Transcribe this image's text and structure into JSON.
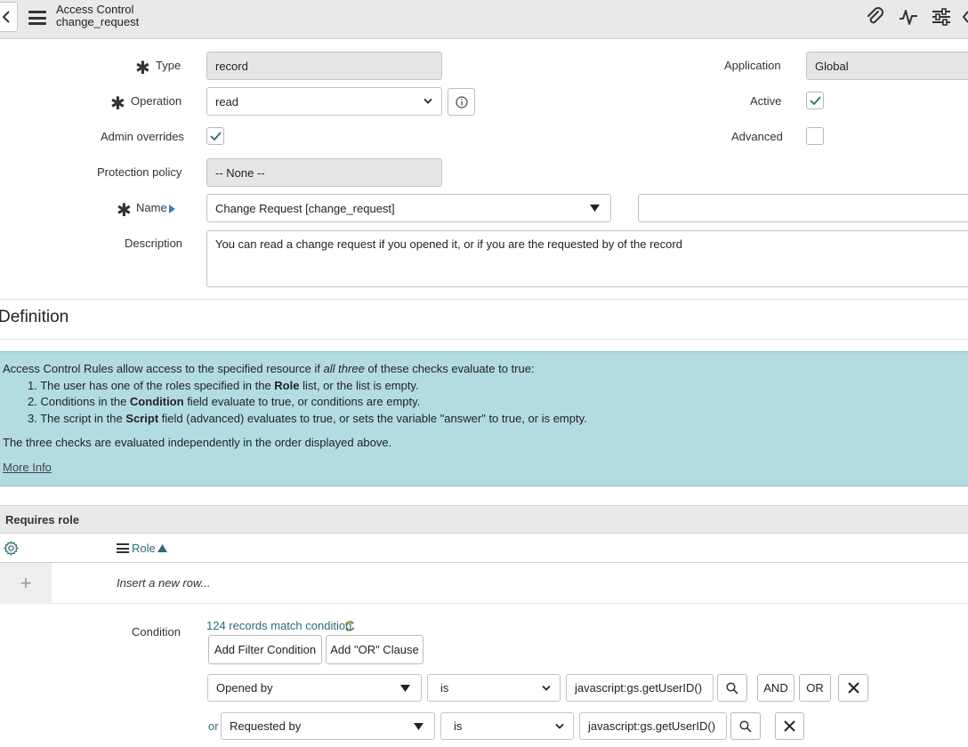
{
  "header": {
    "title": "Access Control",
    "subtitle": "change_request",
    "icons": [
      "back-icon",
      "menu-icon",
      "attachment-icon",
      "activity-icon",
      "settings-sliders-icon",
      "more-icon"
    ]
  },
  "form": {
    "type_label": "Type",
    "type_value": "record",
    "operation_label": "Operation",
    "operation_value": "read",
    "admin_overrides_label": "Admin overrides",
    "admin_overrides_checked": true,
    "protection_policy_label": "Protection policy",
    "protection_policy_value": "-- None --",
    "name_label": "Name",
    "name_value": "Change Request [change_request]",
    "name_field_value": "",
    "description_label": "Description",
    "description_value": "You can read a change request if you opened it, or if you are the requested by of the record",
    "application_label": "Application",
    "application_value": "Global",
    "active_label": "Active",
    "active_checked": true,
    "advanced_label": "Advanced",
    "advanced_checked": false
  },
  "definition": {
    "title": "Definition",
    "intro_before": "Access Control Rules allow access to the specified resource if ",
    "intro_em": "all three",
    "intro_after": " of these checks evaluate to true:",
    "items": [
      {
        "num": "1.",
        "before": "The user has one of the roles specified in the ",
        "bold": "Role",
        "after": " list, or the list is empty."
      },
      {
        "num": "2.",
        "before": "Conditions in the ",
        "bold": "Condition",
        "after": " field evaluate to true, or conditions are empty."
      },
      {
        "num": "3.",
        "before": "The script in the ",
        "bold": "Script",
        "after": " field (advanced) evaluates to true, or sets the variable \"answer\" to true, or is empty."
      }
    ],
    "footer": "The three checks are evaluated independently in the order displayed above.",
    "more_info": "More Info"
  },
  "roles": {
    "section_title": "Requires role",
    "column": "Role",
    "insert_placeholder": "Insert a new row..."
  },
  "condition": {
    "label": "Condition",
    "match_text": "124 records match condition",
    "add_filter": "Add Filter Condition",
    "add_or": "Add \"OR\" Clause",
    "rows": [
      {
        "prefix": "",
        "field": "Opened by",
        "operator": "is",
        "value": "javascript:gs.getUserID()",
        "and": "AND",
        "or": "OR"
      },
      {
        "prefix": "or",
        "field": "Requested by",
        "operator": "is",
        "value": "javascript:gs.getUserID()"
      }
    ]
  }
}
